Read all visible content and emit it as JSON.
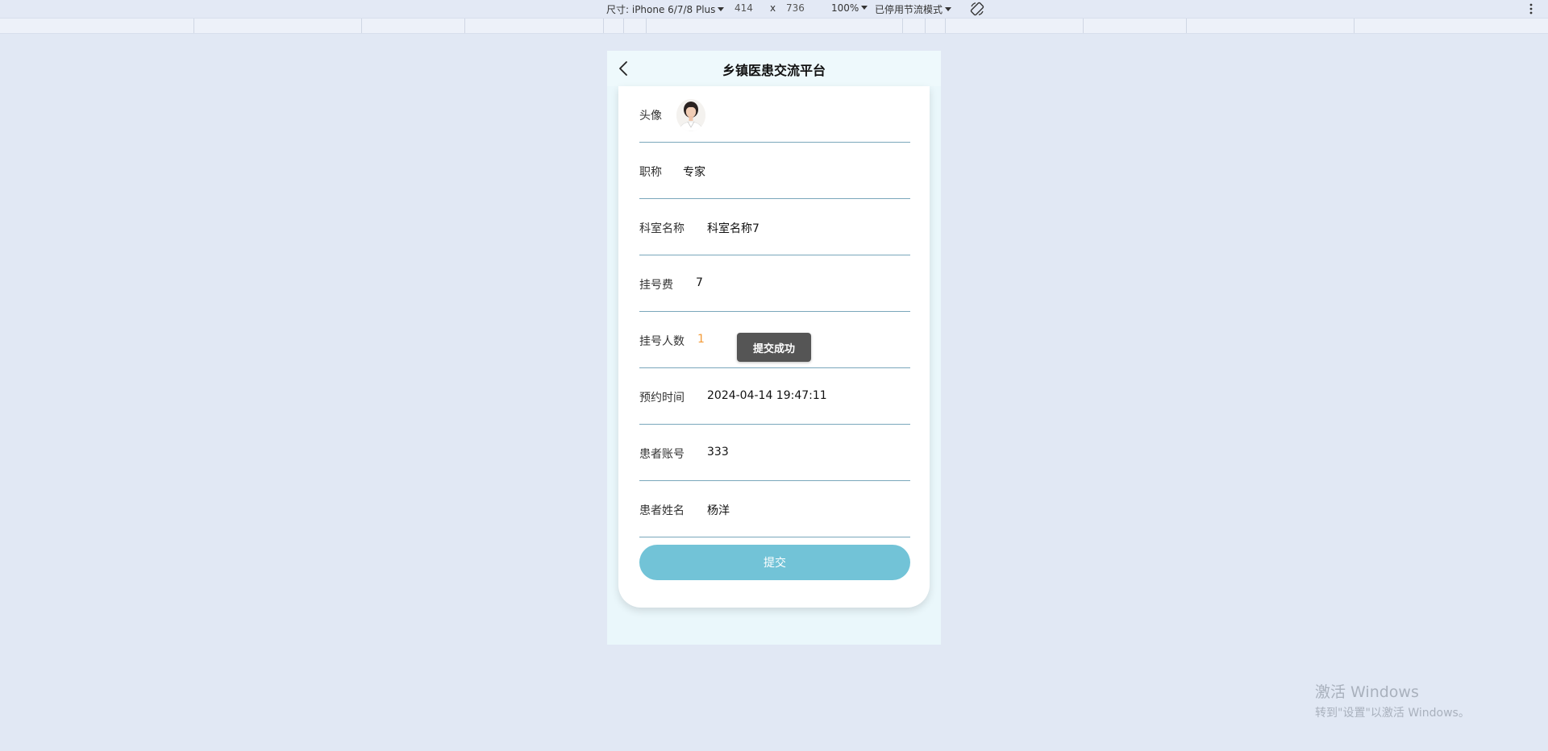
{
  "devtools": {
    "device_label": "尺寸: iPhone 6/7/8 Plus",
    "width": "414",
    "separator": "x",
    "height": "736",
    "zoom": "100%",
    "throttle": "已停用节流模式",
    "rotate_icon": "rotate-icon",
    "menu_icon": "more-vertical-icon"
  },
  "nav": {
    "back_icon": "chevron-left-icon",
    "title": "乡镇医患交流平台"
  },
  "form": {
    "rows": [
      {
        "label": "头像",
        "type": "avatar"
      },
      {
        "label": "职称",
        "value": "专家"
      },
      {
        "label": "科室名称",
        "value": "科室名称7"
      },
      {
        "label": "挂号费",
        "value": "7"
      },
      {
        "label": "挂号人数",
        "value": "1"
      },
      {
        "label": "预约时间",
        "value": "2024-04-14 19:47:11"
      },
      {
        "label": "患者账号",
        "value": "333"
      },
      {
        "label": "患者姓名",
        "value": "杨洋"
      }
    ],
    "submit_label": "提交"
  },
  "toast": {
    "message": "提交成功"
  },
  "watermark": {
    "title": "激活 Windows",
    "subtitle": "转到\"设置\"以激活 Windows。"
  },
  "colors": {
    "page_bg": "#e1e8f4",
    "phone_bg": "#eaf7fb",
    "accent": "#72c3d7",
    "row_divider": "#7aa7bb",
    "count_highlight": "#f39a37",
    "toast_bg": "#555555"
  }
}
